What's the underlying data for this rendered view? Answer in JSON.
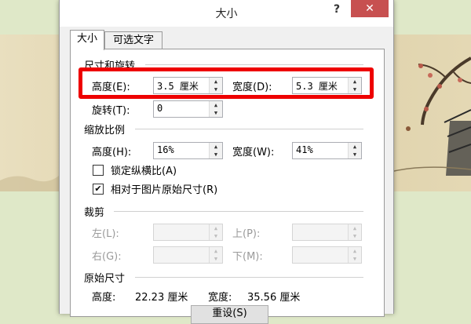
{
  "dialog": {
    "title": "大小",
    "help": "?",
    "close": "✕"
  },
  "tabs": [
    {
      "label": "大小",
      "active": true
    },
    {
      "label": "可选文字",
      "active": false
    }
  ],
  "size_rotate": {
    "title": "尺寸和旋转",
    "height_label": "高度(E):",
    "height_value": "3.5 厘米",
    "width_label": "宽度(D):",
    "width_value": "5.3 厘米",
    "rotate_label": "旋转(T):",
    "rotate_value": "0"
  },
  "scale": {
    "title": "缩放比例",
    "height_label": "高度(H):",
    "height_value": "16%",
    "width_label": "宽度(W):",
    "width_value": "41%",
    "lock_aspect_label": "锁定纵横比(A)",
    "lock_aspect_checked": false,
    "relative_original_label": "相对于图片原始尺寸(R)",
    "relative_original_checked": true
  },
  "crop": {
    "title": "裁剪",
    "left_label": "左(L):",
    "top_label": "上(P):",
    "right_label": "右(G):",
    "bottom_label": "下(M):",
    "left_value": "",
    "top_value": "",
    "right_value": "",
    "bottom_value": ""
  },
  "original": {
    "title": "原始尺寸",
    "height_label": "高度:",
    "height_value": "22.23 厘米",
    "width_label": "宽度:",
    "width_value": "35.56 厘米",
    "reset_label": "重设(S)"
  },
  "colors": {
    "highlight": "#ee0000",
    "close_button": "#c75050"
  },
  "icons": {
    "check": "✔",
    "up": "▲",
    "down": "▼"
  }
}
